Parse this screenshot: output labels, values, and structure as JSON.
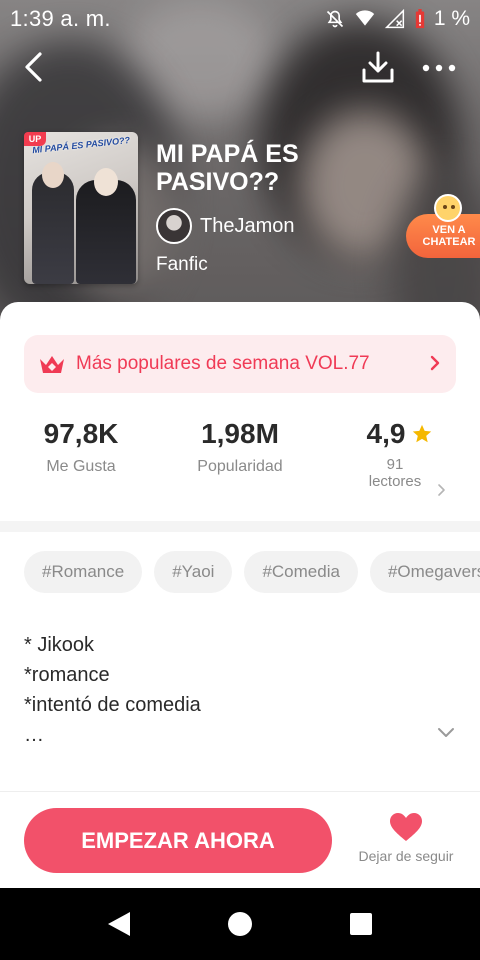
{
  "status_bar": {
    "time": "1:39 a. m.",
    "battery": "1 %",
    "icons": [
      "mute-icon",
      "wifi-icon",
      "signal-icon",
      "battery-alert-icon"
    ]
  },
  "nav": {
    "icons": [
      "back-arrow-icon",
      "download-icon",
      "more-icon"
    ]
  },
  "book": {
    "cover_label": "MI PAPÁ ES PASIVO??",
    "up_badge": "UP",
    "title": "MI PAPÁ ES PASIVO??",
    "author": "TheJamon",
    "category": "Fanfic"
  },
  "chat_badge": {
    "line1": "VEN A",
    "line2": "CHATEAR"
  },
  "rank": {
    "text": "Más populares de semana VOL.77",
    "icon": "crown-icon"
  },
  "stats": {
    "likes": {
      "value": "97,8K",
      "label": "Me Gusta"
    },
    "popularity": {
      "value": "1,98M",
      "label": "Popularidad"
    },
    "rating": {
      "value": "4,9",
      "readers_count": "91",
      "readers_label": "lectores"
    }
  },
  "tags": [
    "#Romance",
    "#Yaoi",
    "#Comedia",
    "#Omegaverse"
  ],
  "synopsis": {
    "line1": "* Jikook",
    "line2": "*romance",
    "line3": "*intentó de comedia",
    "line4": "…"
  },
  "actions": {
    "start_label": "EMPEZAR AHORA",
    "unfollow_label": "Dejar de seguir"
  },
  "colors": {
    "accent": "#F2516A",
    "rank_text": "#F03A55",
    "rank_bg": "#FDECEE",
    "star": "#F5B800",
    "chat_badge": "#F2643C"
  }
}
